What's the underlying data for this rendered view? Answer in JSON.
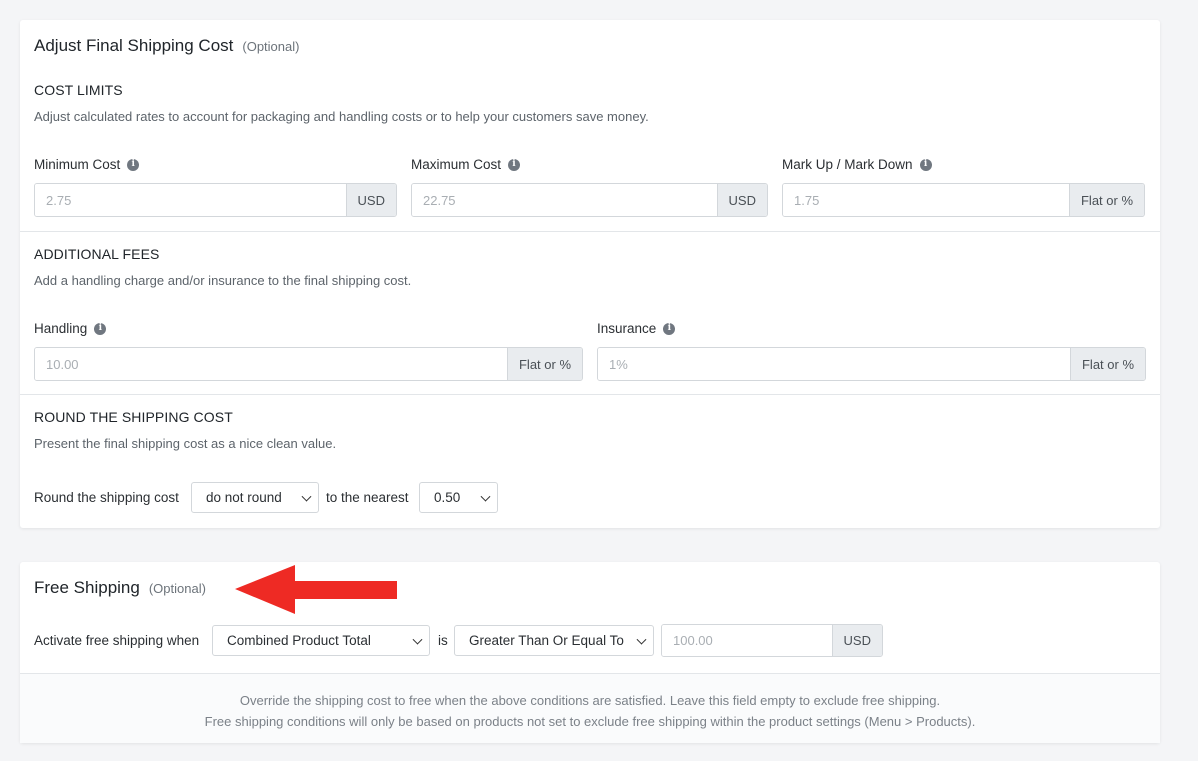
{
  "adjust": {
    "title": "Adjust Final Shipping Cost",
    "optional": "(Optional)",
    "cost_limits": {
      "heading": "COST LIMITS",
      "description": "Adjust calculated rates to account for packaging and handling costs or to help your customers save money.",
      "minimum": {
        "label": "Minimum Cost",
        "placeholder": "2.75",
        "addon": "USD"
      },
      "maximum": {
        "label": "Maximum Cost",
        "placeholder": "22.75",
        "addon": "USD"
      },
      "markup": {
        "label": "Mark Up / Mark Down",
        "placeholder": "1.75",
        "addon": "Flat or %"
      }
    },
    "additional_fees": {
      "heading": "ADDITIONAL FEES",
      "description": "Add a handling charge and/or insurance to the final shipping cost.",
      "handling": {
        "label": "Handling",
        "placeholder": "10.00",
        "addon": "Flat or %"
      },
      "insurance": {
        "label": "Insurance",
        "placeholder": "1%",
        "addon": "Flat or %"
      }
    },
    "rounding": {
      "heading": "ROUND THE SHIPPING COST",
      "description": "Present the final shipping cost as a nice clean value.",
      "label": "Round the shipping cost",
      "mode_value": "do not round",
      "nearest_label": "to the nearest",
      "nearest_value": "0.50"
    }
  },
  "free": {
    "title": "Free Shipping",
    "optional": "(Optional)",
    "activate_label": "Activate free shipping when",
    "condition_value": "Combined Product Total",
    "is_label": "is",
    "operator_value": "Greater Than Or Equal To",
    "amount_placeholder": "100.00",
    "amount_addon": "USD",
    "note_line1": "Override the shipping cost to free when the above conditions are satisfied. Leave this field empty to exclude free shipping.",
    "note_line2": "Free shipping conditions will only be based on products not set to exclude free shipping within the product settings (Menu > Products)."
  },
  "icons": {
    "info": "info-icon",
    "chevron": "chevron-down-icon",
    "arrow": "red-arrow-annotation"
  },
  "colors": {
    "arrow": "#ee2a24",
    "addon_bg": "#e9ecef",
    "page_bg": "#f4f5f7"
  }
}
